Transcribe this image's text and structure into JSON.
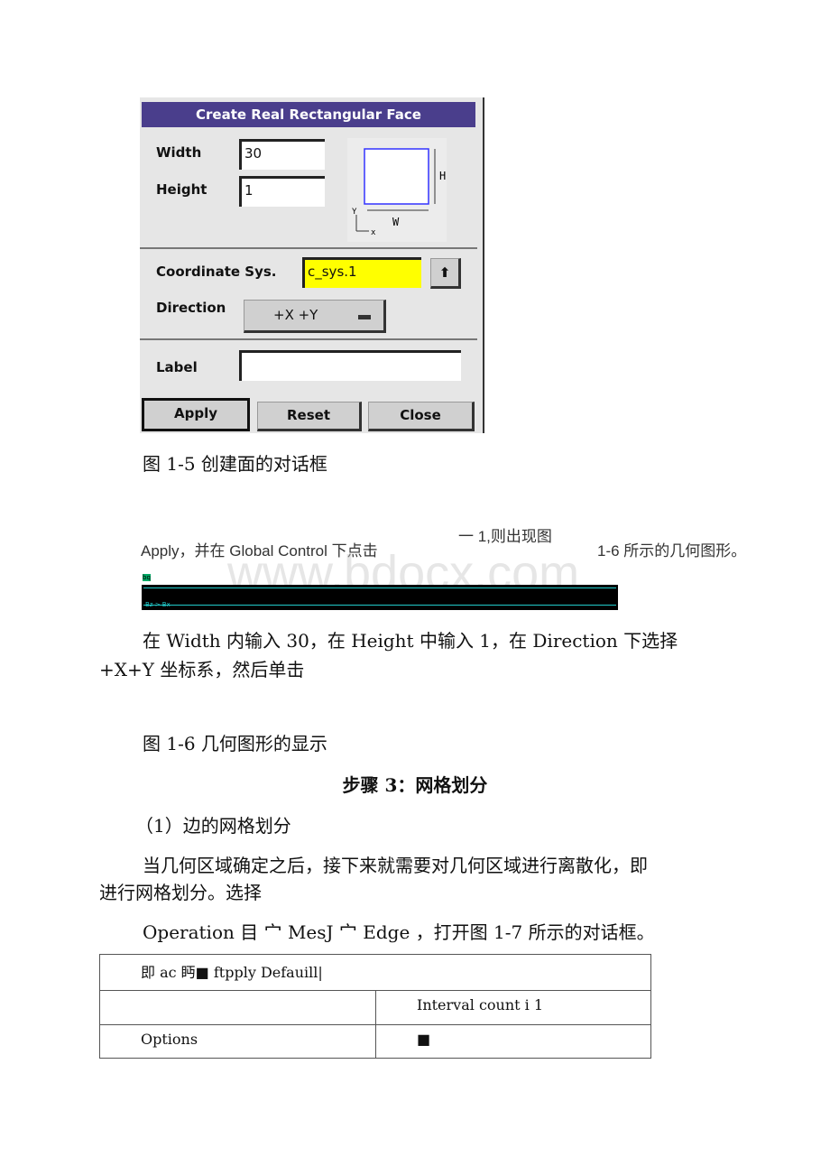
{
  "dialog": {
    "title": "Create Real Rectangular Face",
    "width_label": "Width",
    "width_value": "30",
    "height_label": "Height",
    "height_value": "1",
    "diagram": {
      "h": "H",
      "w": "W",
      "y": "Y",
      "x": "x"
    },
    "coord_label": "Coordinate Sys.",
    "coord_value": "c_sys.1",
    "direction_label": "Direction",
    "direction_value": "+X +Y",
    "label_label": "Label",
    "label_value": "",
    "apply": "Apply",
    "reset": "Reset",
    "close": "Close",
    "colors": {
      "titlebar": "#4a3e8c",
      "coord_field": "#ffff00",
      "preview_rect": "#3333ff"
    }
  },
  "caption1": "图 1-5 创建面的对话框",
  "line_apply_a": "Apply，并在  Global Control  下点击",
  "line_apply_b": "一 1,则出现图",
  "line_apply_c": "1-6 所示的几何图形。",
  "watermark": "www.bdocx.com",
  "geom_labels": {
    "top": "bq",
    "bottom": "Bz  >  Bx"
  },
  "para1_l1": "在 Width 内输入 30，在 Height 中输入 1，在 Direction 下选择",
  "para1_l2": "+X+Y 坐标系，然后单击",
  "caption2": "图 1-6 几何图形的显示",
  "heading": "步骤 3：网格划分",
  "sub1": "（1）边的网格划分",
  "para2_l1": "当几何区域确定之后，接下来就需要对几何区域进行离散化，即",
  "para2_l2": "进行网格划分。选择",
  "para3": "Operation 目 宀 MesJ 宀 Edge ，打开图 1-7 所示的对话框。",
  "table": {
    "r1": "即 ac 眄■ ftpply Defauill|",
    "r2c2": "Interval count i 1",
    "r3c1": "Options",
    "r3c2": "■"
  }
}
